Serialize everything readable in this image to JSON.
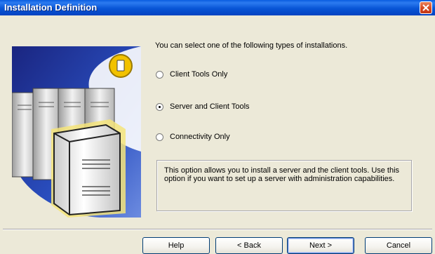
{
  "window": {
    "title": "Installation Definition",
    "close_icon": "close-icon"
  },
  "main": {
    "prompt": "You can select one of the following types of installations.",
    "options": [
      {
        "label": "Client Tools Only",
        "selected": false
      },
      {
        "label": "Server and Client Tools",
        "selected": true
      },
      {
        "label": "Connectivity Only",
        "selected": false
      }
    ],
    "description": "This option allows you to install a server and the client tools. Use this option if you want to set up a server with administration capabilities."
  },
  "illustration": {
    "icon": "server-illustration-icon"
  },
  "buttons": {
    "help": "Help",
    "back": "< Back",
    "next": "Next >",
    "cancel": "Cancel"
  },
  "colors": {
    "title_bar": "#0855D6",
    "dialog_bg": "#ECE9D8",
    "close_button": "#D4441C"
  }
}
